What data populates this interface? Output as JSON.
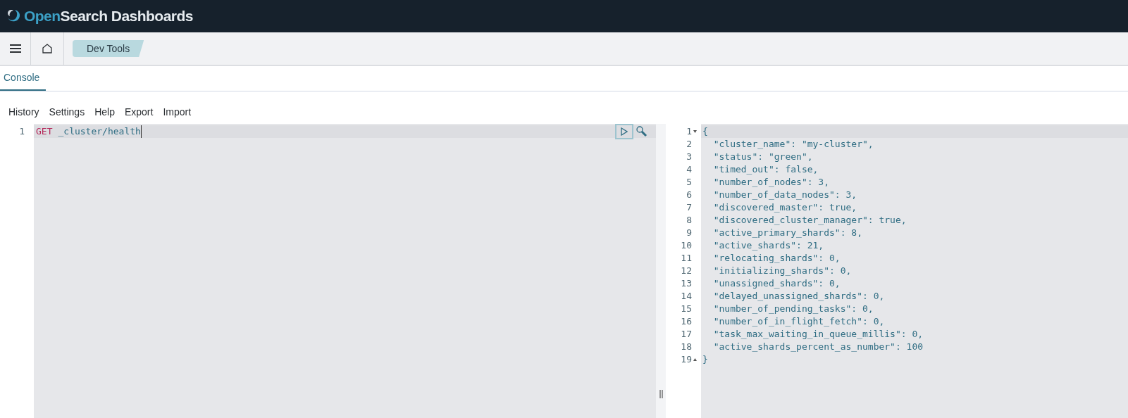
{
  "header": {
    "brand_first": "Open",
    "brand_second": "Search Dashboards"
  },
  "breadcrumbs": [
    {
      "label": "Dev Tools"
    }
  ],
  "tabs": [
    {
      "label": "Console",
      "selected": true
    }
  ],
  "menu": [
    "History",
    "Settings",
    "Help",
    "Export",
    "Import"
  ],
  "request": {
    "lines": [
      {
        "number": "1",
        "method": "GET",
        "path": "_cluster/health"
      }
    ]
  },
  "response": {
    "lines": [
      {
        "number": "1",
        "text": "{",
        "fold_start": true
      },
      {
        "number": "2",
        "text": "  \"cluster_name\": \"my-cluster\","
      },
      {
        "number": "3",
        "text": "  \"status\": \"green\","
      },
      {
        "number": "4",
        "text": "  \"timed_out\": false,"
      },
      {
        "number": "5",
        "text": "  \"number_of_nodes\": 3,"
      },
      {
        "number": "6",
        "text": "  \"number_of_data_nodes\": 3,"
      },
      {
        "number": "7",
        "text": "  \"discovered_master\": true,"
      },
      {
        "number": "8",
        "text": "  \"discovered_cluster_manager\": true,"
      },
      {
        "number": "9",
        "text": "  \"active_primary_shards\": 8,"
      },
      {
        "number": "10",
        "text": "  \"active_shards\": 21,"
      },
      {
        "number": "11",
        "text": "  \"relocating_shards\": 0,"
      },
      {
        "number": "12",
        "text": "  \"initializing_shards\": 0,"
      },
      {
        "number": "13",
        "text": "  \"unassigned_shards\": 0,"
      },
      {
        "number": "14",
        "text": "  \"delayed_unassigned_shards\": 0,"
      },
      {
        "number": "15",
        "text": "  \"number_of_pending_tasks\": 0,"
      },
      {
        "number": "16",
        "text": "  \"number_of_in_flight_fetch\": 0,"
      },
      {
        "number": "17",
        "text": "  \"task_max_waiting_in_queue_millis\": 0,"
      },
      {
        "number": "18",
        "text": "  \"active_shards_percent_as_number\": 100"
      },
      {
        "number": "19",
        "text": "}",
        "fold_end": true
      }
    ]
  }
}
